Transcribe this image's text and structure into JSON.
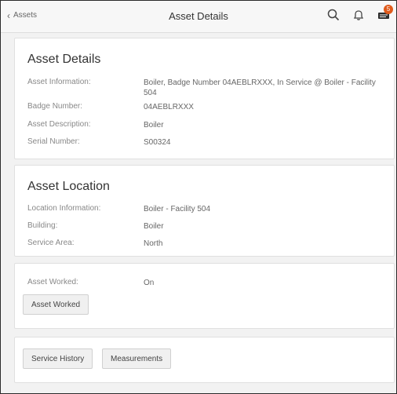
{
  "header": {
    "back_label": "Assets",
    "title": "Asset Details",
    "notification_count": "5"
  },
  "asset_details": {
    "heading": "Asset Details",
    "rows": [
      {
        "label": "Asset Information:",
        "value": "Boiler, Badge Number 04AEBLRXXX, In Service @ Boiler - Facility 504"
      },
      {
        "label": "Badge Number:",
        "value": "04AEBLRXXX"
      },
      {
        "label": "Asset Description:",
        "value": "Boiler"
      },
      {
        "label": "Serial Number:",
        "value": "S00324"
      }
    ]
  },
  "asset_location": {
    "heading": "Asset Location",
    "rows": [
      {
        "label": "Location Information:",
        "value": "Boiler - Facility 504"
      },
      {
        "label": "Building:",
        "value": "Boiler"
      },
      {
        "label": "Service Area:",
        "value": "North"
      }
    ]
  },
  "asset_worked": {
    "label": "Asset Worked:",
    "value": "On",
    "button_label": "Asset Worked"
  },
  "actions": {
    "service_history_label": "Service History",
    "measurements_label": "Measurements"
  }
}
